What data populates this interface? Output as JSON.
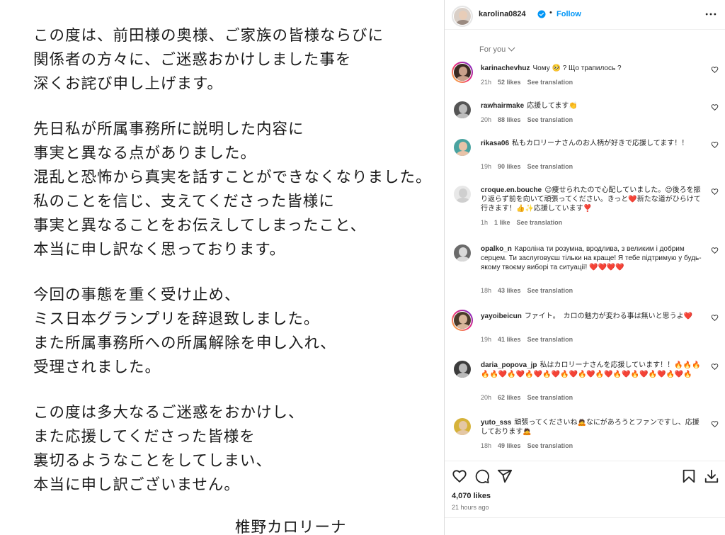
{
  "post_image": {
    "lines": [
      "この度は、前田様の奥様、ご家族の皆様ならびに",
      "関係者の方々に、ご迷惑おかけしました事を",
      "深くお詫び申し上げます。",
      "先日私が所属事務所に説明した内容に",
      "事実と異なる点がありました。",
      "混乱と恐怖から真実を話すことができなくなりました。",
      "私のことを信じ、支えてくださった皆様に",
      "事実と異なることをお伝えしてしまったこと、",
      "本当に申し訳なく思っております。",
      "今回の事態を重く受け止め、",
      "ミス日本グランプリを辞退致しました。",
      "また所属事務所への所属解除を申し入れ、",
      "受理されました。",
      "この度は多大なるご迷惑をおかけし、",
      "また応援してくださった皆様を",
      "裏切るようなことをしてしまい、",
      "本当に申し訳ございません。"
    ],
    "signature": "椎野カロリーナ"
  },
  "header": {
    "username": "karolina0824",
    "separator": "•",
    "follow_label": "Follow",
    "verified_icon": "verified-badge-icon",
    "more_icon": "more-options-icon"
  },
  "sort": {
    "label": "For you"
  },
  "comments": [
    {
      "user": "karinachevhuz",
      "text": "Чому 🥺 ? Що трапилось ?",
      "time": "21h",
      "likes": "52 likes",
      "translate": "See translation",
      "avatar_color": "#3a2a22",
      "skin": "#c9a08a"
    },
    {
      "user": "rawhairmake",
      "text": "応援してます👏",
      "time": "20h",
      "likes": "88 likes",
      "translate": "See translation",
      "avatar_color": "#555555",
      "skin": "#bdbdbd"
    },
    {
      "user": "rikasa06",
      "text": "私もカロリーナさんのお人柄が好きで応援してます！！",
      "time": "19h",
      "likes": "90 likes",
      "translate": "See translation",
      "avatar_color": "#4aa3a0",
      "skin": "#e9c3a8"
    },
    {
      "user": "croque.en.bouche",
      "text": "😉痩せられたので心配していました。😍後ろを振り返らず前を向いて頑張ってください。きっと❤️新たな道がひらけて行きます！👍✨応援しています❣️",
      "time": "1h",
      "likes": "1 like",
      "translate": "See translation",
      "avatar_color": "#e8e8e8",
      "skin": "#cfcfcf"
    },
    {
      "user": "opalko_n",
      "text": "Кароліна ти розумна, вродлива, з великим і добрим серцем. Ти заслуговуєш тільки на краще! Я тебе підтримую у будь-якому твоєму виборі та ситуації! ❤️❤️❤️❤️",
      "time": "18h",
      "likes": "43 likes",
      "translate": "See translation",
      "avatar_color": "#6b6b6b",
      "skin": "#d9d9d9"
    },
    {
      "user": "yayoibeicun",
      "text": "ファイト。　カロの魅力が変わる事は無いと思うよ❤️",
      "time": "19h",
      "likes": "41 likes",
      "translate": "See translation",
      "avatar_color": "#4b3b2b",
      "skin": "#d8b59a"
    },
    {
      "user": "daria_popova_jp",
      "text": "私はカロリーナさんを応援しています！！🔥🔥🔥🔥🔥❤️🔥❤️🔥❤️🔥❤️🔥❤️🔥❤️🔥❤️🔥❤️🔥❤️🔥❤️🔥❤️🔥",
      "time": "20h",
      "likes": "62 likes",
      "translate": "See translation",
      "avatar_color": "#3c3c3c",
      "skin": "#b9b9b9"
    },
    {
      "user": "yuto_sss",
      "text": "頑張ってくださいね🙇なにがあろうとファンですし、応援しております🙇",
      "time": "18h",
      "likes": "49 likes",
      "translate": "See translation",
      "avatar_color": "#d6b23a",
      "skin": "#e4c7a5"
    }
  ],
  "actions": {
    "like_icon": "heart-icon",
    "comment_icon": "comment-icon",
    "share_icon": "share-icon",
    "save_icon": "bookmark-icon",
    "download_icon": "download-icon"
  },
  "likes": "4,070 likes",
  "time_ago": "21 hours ago",
  "add_comment": {
    "placeholder": ""
  },
  "colors": {
    "link_blue": "#0095f6",
    "text": "#262626",
    "muted": "#737373",
    "heart_red": "#e0245e"
  }
}
